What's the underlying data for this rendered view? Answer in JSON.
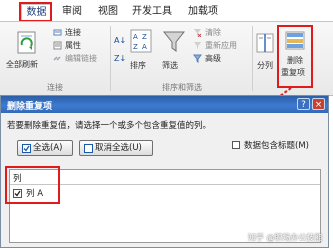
{
  "ribbon_tabs": [
    "数据",
    "审阅",
    "视图",
    "开发工具",
    "加载项"
  ],
  "ribbon": {
    "refresh_all": "全部刷新",
    "connections": "连接",
    "properties": "属性",
    "edit_links": "编辑链接",
    "connections_group": "连接",
    "sort": "排序",
    "filter": "筛选",
    "clear": "清除",
    "reapply": "重新应用",
    "advanced": "高级",
    "sort_filter_group": "排序和筛选",
    "text_to_columns": "分列",
    "remove_duplicates_line1": "删除",
    "remove_duplicates_line2": "重复项"
  },
  "dialog": {
    "title": "删除重复项",
    "help_glyph": "?",
    "close_glyph": "×",
    "instruction": "若要删除重复值，请选择一个或多个包含重复值的列。",
    "select_all": "全选(A)",
    "unselect_all": "取消全选(U)",
    "has_headers": "数据包含标题(M)",
    "list_header": "列",
    "columns": [
      {
        "label": "列 A",
        "checked": true
      }
    ]
  },
  "watermark": "知乎 @职场办公技能",
  "colors": {
    "highlight": "#e01b1b",
    "title_bar": "#3d7bd1"
  }
}
